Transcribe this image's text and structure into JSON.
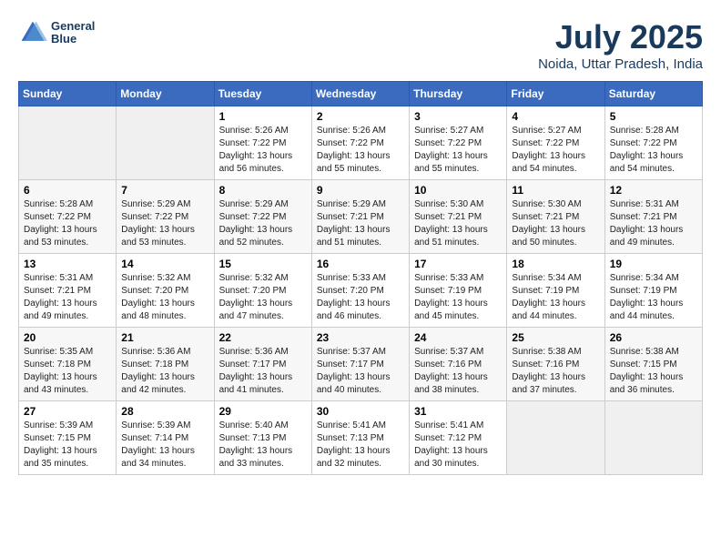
{
  "header": {
    "logo_line1": "General",
    "logo_line2": "Blue",
    "month": "July 2025",
    "location": "Noida, Uttar Pradesh, India"
  },
  "days_of_week": [
    "Sunday",
    "Monday",
    "Tuesday",
    "Wednesday",
    "Thursday",
    "Friday",
    "Saturday"
  ],
  "weeks": [
    [
      {
        "day": "",
        "info": ""
      },
      {
        "day": "",
        "info": ""
      },
      {
        "day": "1",
        "info": "Sunrise: 5:26 AM\nSunset: 7:22 PM\nDaylight: 13 hours and 56 minutes."
      },
      {
        "day": "2",
        "info": "Sunrise: 5:26 AM\nSunset: 7:22 PM\nDaylight: 13 hours and 55 minutes."
      },
      {
        "day": "3",
        "info": "Sunrise: 5:27 AM\nSunset: 7:22 PM\nDaylight: 13 hours and 55 minutes."
      },
      {
        "day": "4",
        "info": "Sunrise: 5:27 AM\nSunset: 7:22 PM\nDaylight: 13 hours and 54 minutes."
      },
      {
        "day": "5",
        "info": "Sunrise: 5:28 AM\nSunset: 7:22 PM\nDaylight: 13 hours and 54 minutes."
      }
    ],
    [
      {
        "day": "6",
        "info": "Sunrise: 5:28 AM\nSunset: 7:22 PM\nDaylight: 13 hours and 53 minutes."
      },
      {
        "day": "7",
        "info": "Sunrise: 5:29 AM\nSunset: 7:22 PM\nDaylight: 13 hours and 53 minutes."
      },
      {
        "day": "8",
        "info": "Sunrise: 5:29 AM\nSunset: 7:22 PM\nDaylight: 13 hours and 52 minutes."
      },
      {
        "day": "9",
        "info": "Sunrise: 5:29 AM\nSunset: 7:21 PM\nDaylight: 13 hours and 51 minutes."
      },
      {
        "day": "10",
        "info": "Sunrise: 5:30 AM\nSunset: 7:21 PM\nDaylight: 13 hours and 51 minutes."
      },
      {
        "day": "11",
        "info": "Sunrise: 5:30 AM\nSunset: 7:21 PM\nDaylight: 13 hours and 50 minutes."
      },
      {
        "day": "12",
        "info": "Sunrise: 5:31 AM\nSunset: 7:21 PM\nDaylight: 13 hours and 49 minutes."
      }
    ],
    [
      {
        "day": "13",
        "info": "Sunrise: 5:31 AM\nSunset: 7:21 PM\nDaylight: 13 hours and 49 minutes."
      },
      {
        "day": "14",
        "info": "Sunrise: 5:32 AM\nSunset: 7:20 PM\nDaylight: 13 hours and 48 minutes."
      },
      {
        "day": "15",
        "info": "Sunrise: 5:32 AM\nSunset: 7:20 PM\nDaylight: 13 hours and 47 minutes."
      },
      {
        "day": "16",
        "info": "Sunrise: 5:33 AM\nSunset: 7:20 PM\nDaylight: 13 hours and 46 minutes."
      },
      {
        "day": "17",
        "info": "Sunrise: 5:33 AM\nSunset: 7:19 PM\nDaylight: 13 hours and 45 minutes."
      },
      {
        "day": "18",
        "info": "Sunrise: 5:34 AM\nSunset: 7:19 PM\nDaylight: 13 hours and 44 minutes."
      },
      {
        "day": "19",
        "info": "Sunrise: 5:34 AM\nSunset: 7:19 PM\nDaylight: 13 hours and 44 minutes."
      }
    ],
    [
      {
        "day": "20",
        "info": "Sunrise: 5:35 AM\nSunset: 7:18 PM\nDaylight: 13 hours and 43 minutes."
      },
      {
        "day": "21",
        "info": "Sunrise: 5:36 AM\nSunset: 7:18 PM\nDaylight: 13 hours and 42 minutes."
      },
      {
        "day": "22",
        "info": "Sunrise: 5:36 AM\nSunset: 7:17 PM\nDaylight: 13 hours and 41 minutes."
      },
      {
        "day": "23",
        "info": "Sunrise: 5:37 AM\nSunset: 7:17 PM\nDaylight: 13 hours and 40 minutes."
      },
      {
        "day": "24",
        "info": "Sunrise: 5:37 AM\nSunset: 7:16 PM\nDaylight: 13 hours and 38 minutes."
      },
      {
        "day": "25",
        "info": "Sunrise: 5:38 AM\nSunset: 7:16 PM\nDaylight: 13 hours and 37 minutes."
      },
      {
        "day": "26",
        "info": "Sunrise: 5:38 AM\nSunset: 7:15 PM\nDaylight: 13 hours and 36 minutes."
      }
    ],
    [
      {
        "day": "27",
        "info": "Sunrise: 5:39 AM\nSunset: 7:15 PM\nDaylight: 13 hours and 35 minutes."
      },
      {
        "day": "28",
        "info": "Sunrise: 5:39 AM\nSunset: 7:14 PM\nDaylight: 13 hours and 34 minutes."
      },
      {
        "day": "29",
        "info": "Sunrise: 5:40 AM\nSunset: 7:13 PM\nDaylight: 13 hours and 33 minutes."
      },
      {
        "day": "30",
        "info": "Sunrise: 5:41 AM\nSunset: 7:13 PM\nDaylight: 13 hours and 32 minutes."
      },
      {
        "day": "31",
        "info": "Sunrise: 5:41 AM\nSunset: 7:12 PM\nDaylight: 13 hours and 30 minutes."
      },
      {
        "day": "",
        "info": ""
      },
      {
        "day": "",
        "info": ""
      }
    ]
  ]
}
